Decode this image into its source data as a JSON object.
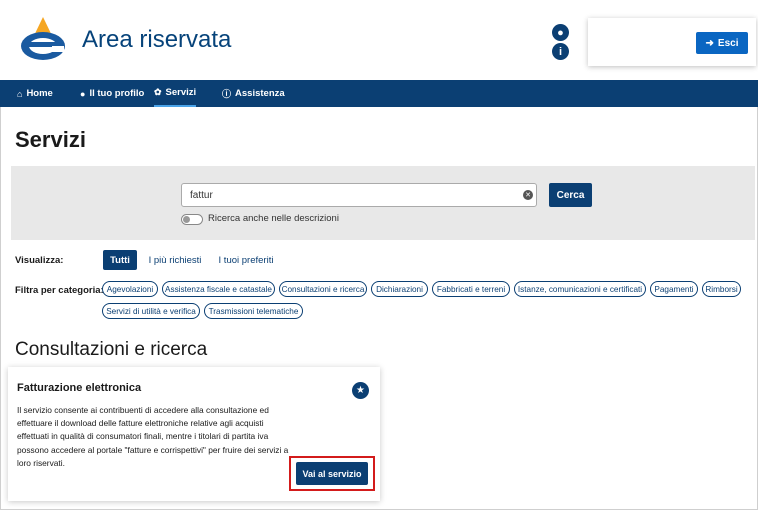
{
  "header": {
    "title": "Area riservata",
    "logout_label": "Esci"
  },
  "nav": {
    "items": [
      {
        "label": "Home",
        "icon": "home-icon"
      },
      {
        "label": "Il tuo profilo",
        "icon": "user-icon"
      },
      {
        "label": "Servizi",
        "icon": "services-icon"
      },
      {
        "label": "Assistenza",
        "icon": "info-icon"
      }
    ],
    "active": "Servizi"
  },
  "page": {
    "title": "Servizi"
  },
  "search": {
    "value": "fattur",
    "button_label": "Cerca",
    "toggle_label": "Ricerca anche nelle descrizioni"
  },
  "view": {
    "label": "Visualizza:",
    "tabs": [
      "Tutti",
      "I più richiesti",
      "I tuoi preferiti"
    ],
    "active": "Tutti"
  },
  "filter": {
    "label": "Filtra per categoria:",
    "categories": [
      "Agevolazioni",
      "Assistenza fiscale e catastale",
      "Consultazioni e ricerca",
      "Dichiarazioni",
      "Fabbricati e terreni",
      "Istanze, comunicazioni e certificati",
      "Pagamenti",
      "Rimborsi",
      "Servizi di utilità e verifica",
      "Trasmissioni telematiche"
    ]
  },
  "section": {
    "title": "Consultazioni e ricerca"
  },
  "card": {
    "title": "Fatturazione elettronica",
    "description": "Il servizio consente ai contribuenti di accedere alla consultazione ed effettuare il download delle fatture elettroniche relative agli acquisti effettuati in qualità di consumatori finali, mentre i titolari di partita iva possono accedere al portale \"fatture e corrispettivi\" per fruire dei servizi a loro riservati.",
    "button_label": "Vai al servizio"
  },
  "colors": {
    "brand": "#0b3f73",
    "highlight": "#d31b1b"
  }
}
